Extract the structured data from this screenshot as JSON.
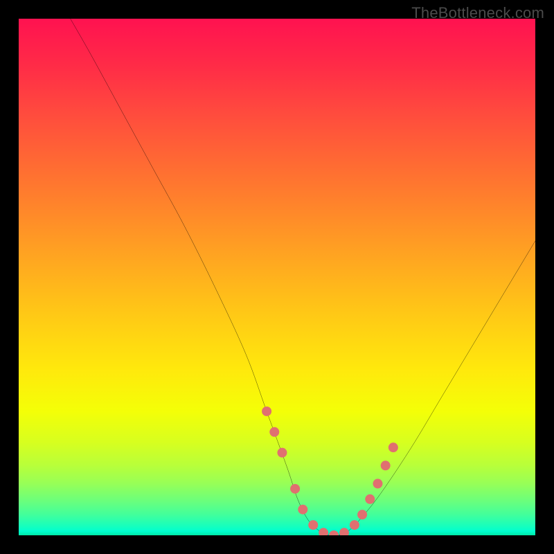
{
  "watermark": "TheBottleneck.com",
  "chart_data": {
    "type": "line",
    "title": "",
    "xlabel": "",
    "ylabel": "",
    "xlim": [
      0,
      100
    ],
    "ylim": [
      0,
      100
    ],
    "grid": false,
    "series": [
      {
        "name": "curve",
        "color": "#000000",
        "x": [
          10,
          14,
          20,
          26,
          32,
          38,
          44,
          48,
          52,
          54,
          56,
          58,
          60,
          62,
          64,
          66,
          70,
          76,
          82,
          88,
          94,
          100
        ],
        "y": [
          100,
          93,
          82,
          71,
          60,
          48,
          35,
          24,
          13,
          7,
          3,
          1,
          0,
          0,
          1,
          3,
          8,
          17,
          27,
          37,
          47,
          57
        ]
      }
    ],
    "markers": {
      "name": "highlight-dots",
      "color": "#e07070",
      "radius": 7,
      "x": [
        48,
        49.5,
        51,
        53.5,
        55,
        57,
        59,
        61,
        63,
        65,
        66.5,
        68,
        69.5,
        71,
        72.5
      ],
      "y": [
        24,
        20,
        16,
        9,
        5,
        2,
        0.5,
        0,
        0.5,
        2,
        4,
        7,
        10,
        13.5,
        17
      ]
    },
    "gradient_stops": [
      {
        "pos": 0,
        "color": "#ff1250"
      },
      {
        "pos": 0.5,
        "color": "#ffcb15"
      },
      {
        "pos": 0.8,
        "color": "#f4ff07"
      },
      {
        "pos": 1.0,
        "color": "#00e8a7"
      }
    ]
  }
}
